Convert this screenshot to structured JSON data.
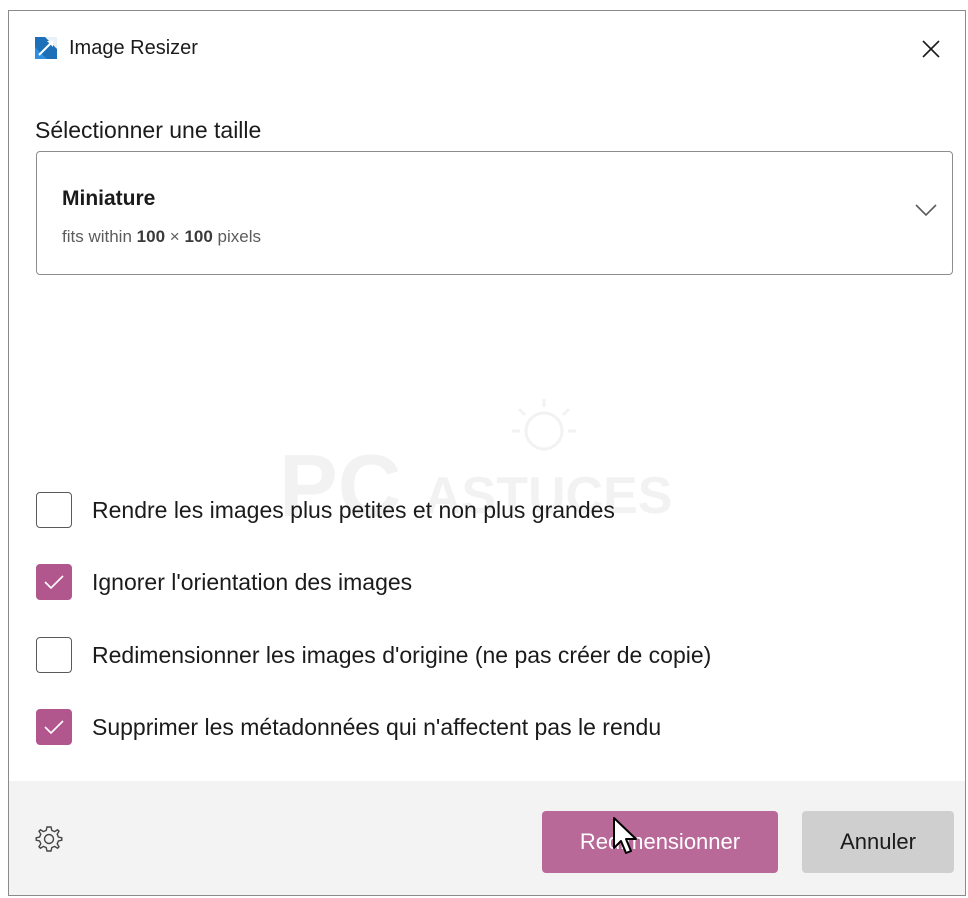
{
  "window": {
    "title": "Image Resizer",
    "app_icon": "image-resizer-app-icon",
    "close_icon": "close-icon"
  },
  "size_section": {
    "label": "Sélectionner une taille",
    "selected": {
      "name": "Miniature",
      "desc_prefix": "fits within",
      "width": "100",
      "times": "×",
      "height": "100",
      "unit": "pixels"
    },
    "dropdown_icon": "chevron-down-icon"
  },
  "watermark": {
    "text_main": "PC",
    "text_sub": "ASTUCES"
  },
  "options": [
    {
      "label": "Rendre les images plus petites et non plus grandes",
      "checked": false
    },
    {
      "label": "Ignorer l'orientation des images",
      "checked": true
    },
    {
      "label": "Redimensionner les images d'origine (ne pas créer de copie)",
      "checked": false
    },
    {
      "label": "Supprimer les métadonnées qui n'affectent pas le rendu",
      "checked": true
    }
  ],
  "footer": {
    "settings_icon": "gear-icon",
    "resize_label": "Redimensionner",
    "cancel_label": "Annuler"
  },
  "colors": {
    "accent": "#b96998",
    "checkbox_checked": "#b2578e",
    "footer_bg": "#f3f3f3",
    "secondary_button": "#cfcfcf"
  }
}
